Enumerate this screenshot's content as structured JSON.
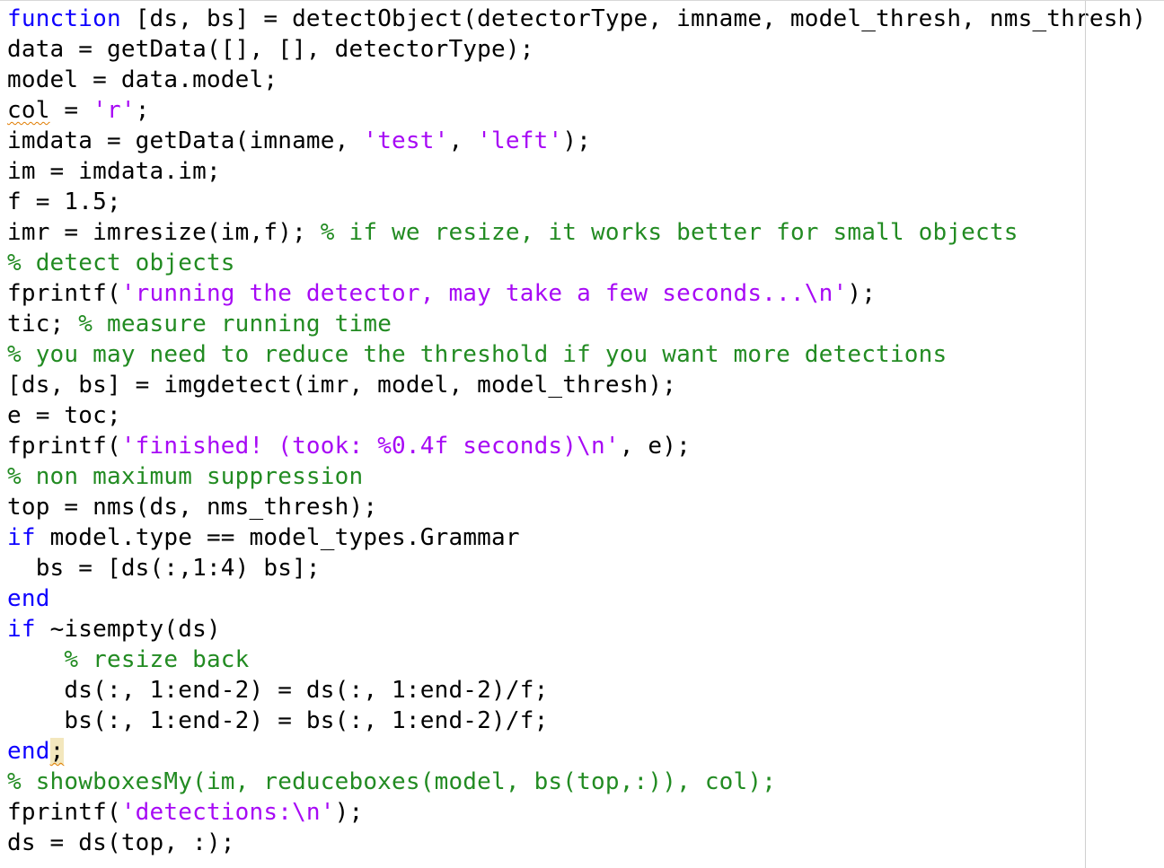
{
  "editor": {
    "colors": {
      "keyword": "#0e00ff",
      "string": "#a709f5",
      "comment": "#228b22",
      "plain": "#000000",
      "warning_squiggle": "#e07b00",
      "bracket_highlight": "#f3e7bd"
    },
    "lines": [
      [
        {
          "t": "kw",
          "v": "function"
        },
        {
          "t": "plain",
          "v": " [ds, bs] = detectObject(detectorType, imname, model_thresh, nms_thresh)"
        }
      ],
      [
        {
          "t": "plain",
          "v": "data = getData([], [], detectorType);"
        }
      ],
      [
        {
          "t": "plain",
          "v": "model = data.model;"
        }
      ],
      [
        {
          "t": "plain",
          "v": "col",
          "squiggle": true
        },
        {
          "t": "plain",
          "v": " = "
        },
        {
          "t": "str",
          "v": "'r'"
        },
        {
          "t": "plain",
          "v": ";"
        }
      ],
      [
        {
          "t": "plain",
          "v": "imdata = getData(imname, "
        },
        {
          "t": "str",
          "v": "'test'"
        },
        {
          "t": "plain",
          "v": ", "
        },
        {
          "t": "str",
          "v": "'left'"
        },
        {
          "t": "plain",
          "v": ");"
        }
      ],
      [
        {
          "t": "plain",
          "v": "im = imdata.im;"
        }
      ],
      [
        {
          "t": "plain",
          "v": "f = 1.5;"
        }
      ],
      [
        {
          "t": "plain",
          "v": "imr = imresize(im,f); "
        },
        {
          "t": "cmt",
          "v": "% if we resize, it works better for small objects"
        }
      ],
      [
        {
          "t": "cmt",
          "v": "% detect objects"
        }
      ],
      [
        {
          "t": "plain",
          "v": "fprintf("
        },
        {
          "t": "str",
          "v": "'running the detector, may take a few seconds...\\n'"
        },
        {
          "t": "plain",
          "v": ");"
        }
      ],
      [
        {
          "t": "plain",
          "v": "tic; "
        },
        {
          "t": "cmt",
          "v": "% measure running time"
        }
      ],
      [
        {
          "t": "cmt",
          "v": "% you may need to reduce the threshold if you want more detections"
        }
      ],
      [
        {
          "t": "plain",
          "v": "[ds, bs] = imgdetect(imr, model, model_thresh);"
        }
      ],
      [
        {
          "t": "plain",
          "v": "e = toc;"
        }
      ],
      [
        {
          "t": "plain",
          "v": "fprintf("
        },
        {
          "t": "str",
          "v": "'finished! (took: %0.4f seconds)\\n'"
        },
        {
          "t": "plain",
          "v": ", e);"
        }
      ],
      [
        {
          "t": "cmt",
          "v": "% non maximum suppression"
        }
      ],
      [
        {
          "t": "plain",
          "v": "top = nms(ds, nms_thresh);"
        }
      ],
      [
        {
          "t": "kw",
          "v": "if"
        },
        {
          "t": "plain",
          "v": " model.type == model_types.Grammar"
        }
      ],
      [
        {
          "t": "plain",
          "v": "  bs = [ds(:,1:4) bs];"
        }
      ],
      [
        {
          "t": "kw",
          "v": "end"
        }
      ],
      [
        {
          "t": "kw",
          "v": "if"
        },
        {
          "t": "plain",
          "v": " ~isempty(ds)"
        }
      ],
      [
        {
          "t": "plain",
          "v": "    "
        },
        {
          "t": "cmt",
          "v": "% resize back"
        }
      ],
      [
        {
          "t": "plain",
          "v": "    ds(:, 1:end-2) = ds(:, 1:end-2)/f;"
        }
      ],
      [
        {
          "t": "plain",
          "v": "    bs(:, 1:end-2) = bs(:, 1:end-2)/f;"
        }
      ],
      [
        {
          "t": "kw",
          "v": "end"
        },
        {
          "t": "plain",
          "v": ";",
          "highlight": true,
          "squiggle": true
        }
      ],
      [
        {
          "t": "cmt",
          "v": "% showboxesMy(im, reduceboxes(model, bs(top,:)), col);"
        }
      ],
      [
        {
          "t": "plain",
          "v": "fprintf("
        },
        {
          "t": "str",
          "v": "'detections:\\n'"
        },
        {
          "t": "plain",
          "v": ");"
        }
      ],
      [
        {
          "t": "plain",
          "v": "ds = ds(top, :);"
        }
      ]
    ]
  }
}
